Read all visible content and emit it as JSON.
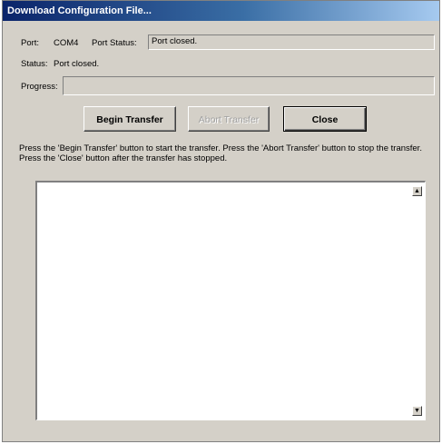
{
  "window": {
    "title": "Download Configuration File..."
  },
  "port": {
    "label": "Port:",
    "value": "COM4",
    "status_label": "Port Status:",
    "status_value": "Port closed."
  },
  "status": {
    "label": "Status:",
    "value": "Port closed."
  },
  "progress": {
    "label": "Progress:",
    "value": ""
  },
  "buttons": {
    "begin": "Begin Transfer",
    "abort": "Abort Transfer",
    "close": "Close"
  },
  "instructions": "Press the 'Begin Transfer' button to start the transfer.  Press the 'Abort Transfer' button to stop the transfer.  Press the 'Close' button after the transfer has stopped.",
  "log": {
    "text": ""
  },
  "icons": {
    "scroll_up": "scroll-up-arrow",
    "scroll_down": "scroll-down-arrow"
  }
}
